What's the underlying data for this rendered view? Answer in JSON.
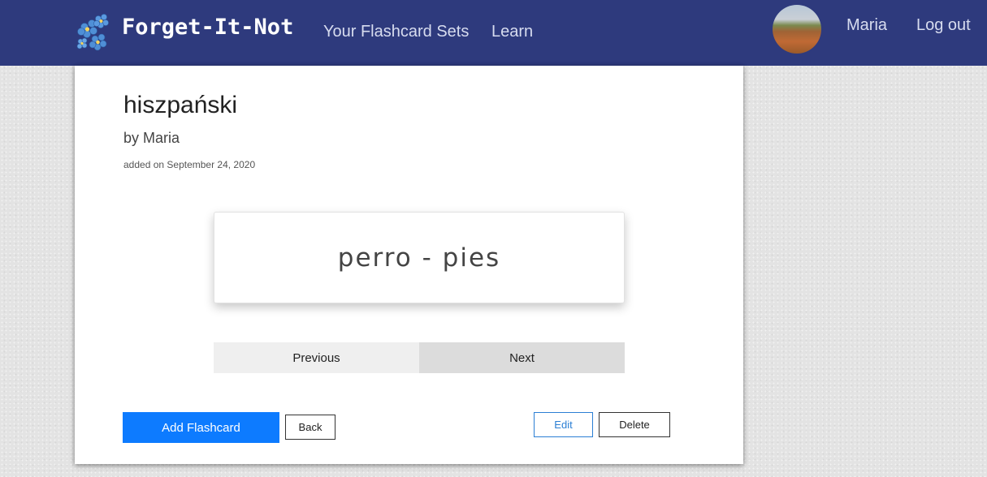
{
  "navbar": {
    "brand": "Forget-It-Not",
    "links": {
      "sets": "Your Flashcard Sets",
      "learn": "Learn"
    },
    "user_name": "Maria",
    "logout": "Log out"
  },
  "set": {
    "title": "hiszpański",
    "author": "by Maria",
    "date": "added on September 24, 2020"
  },
  "flashcard": {
    "text": "perro - pies"
  },
  "pager": {
    "previous": "Previous",
    "next": "Next"
  },
  "actions": {
    "add": "Add Flashcard",
    "back": "Back",
    "edit": "Edit",
    "delete": "Delete"
  },
  "colors": {
    "navbar": "#2e3a7d",
    "primary": "#0d7bff",
    "edit": "#2b7fd4"
  },
  "icons": {
    "logo": "forget-me-not-flower-icon"
  }
}
